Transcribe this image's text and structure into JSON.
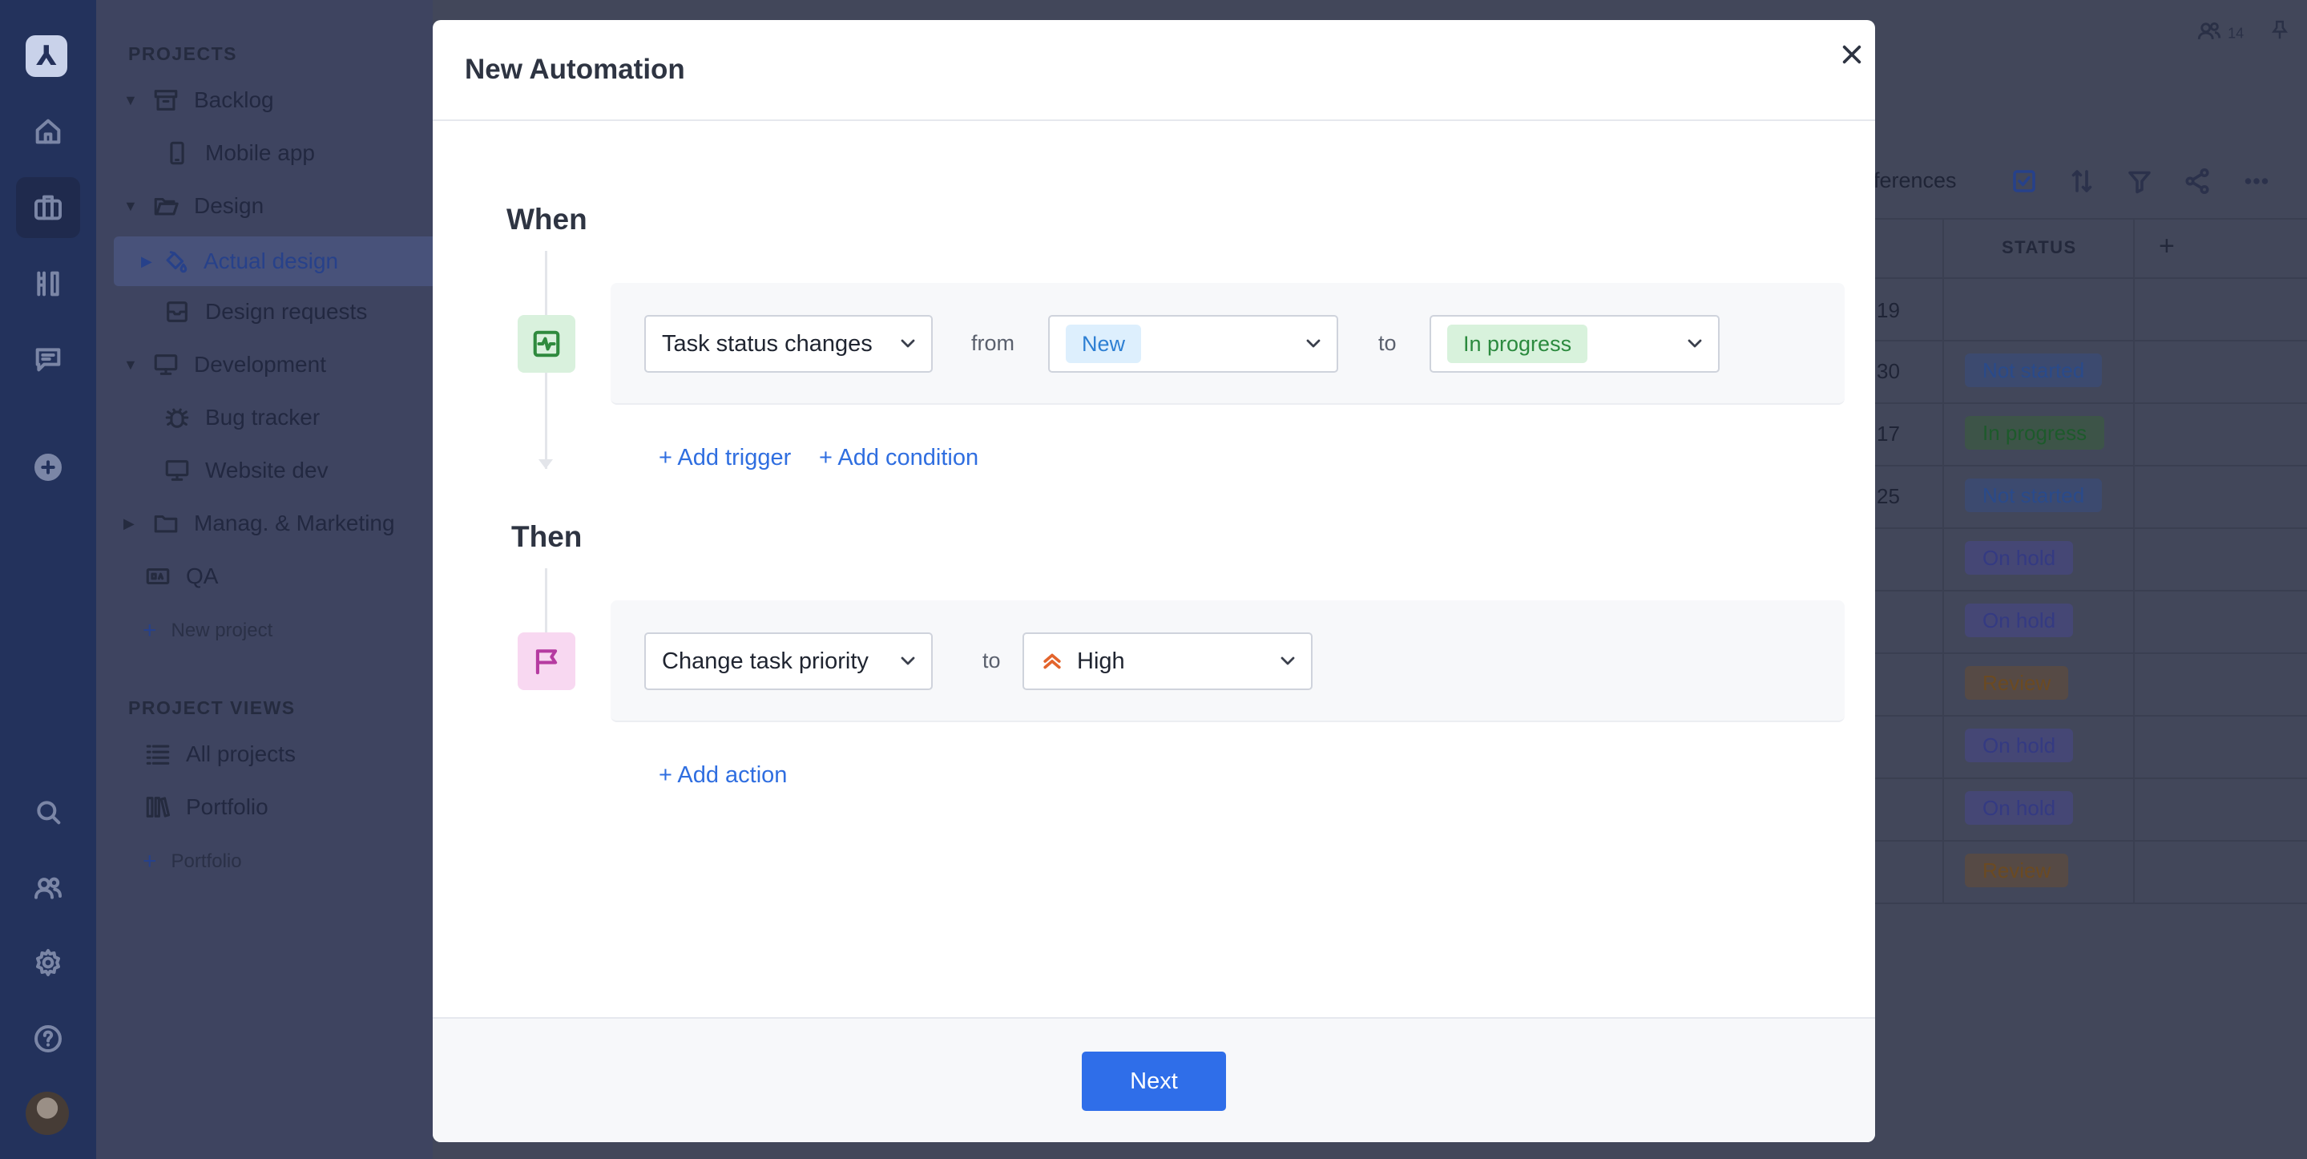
{
  "sidebar": {
    "projects_heading": "PROJECTS",
    "items": [
      {
        "label": "Backlog",
        "icon": "archive-icon"
      },
      {
        "label": "Mobile app",
        "icon": "phone-icon"
      },
      {
        "label": "Design",
        "icon": "folder-open-icon"
      },
      {
        "label": "Actual design",
        "icon": "paint-bucket-icon"
      },
      {
        "label": "Design requests",
        "icon": "inbox-icon"
      },
      {
        "label": "Development",
        "icon": "monitor-icon"
      },
      {
        "label": "Bug tracker",
        "icon": "bug-icon"
      },
      {
        "label": "Website dev",
        "icon": "monitor-icon"
      },
      {
        "label": "Manag. & Marketing",
        "icon": "folder-icon"
      },
      {
        "label": "QA",
        "icon": "qa-icon"
      }
    ],
    "new_project": "New project",
    "views_heading": "PROJECT VIEWS",
    "views": [
      {
        "label": "All projects",
        "icon": "list-icon"
      },
      {
        "label": "Portfolio",
        "icon": "books-icon"
      }
    ],
    "add_portfolio": "Portfolio"
  },
  "background": {
    "members_count": "14",
    "toolbar_text": "ferences",
    "status_header": "STATUS",
    "add_column": "+",
    "rows": [
      {
        "num": "19",
        "status": ""
      },
      {
        "num": "30",
        "status": "Not started",
        "kind": "notstarted"
      },
      {
        "num": "17",
        "status": "In progress",
        "kind": "inprogress"
      },
      {
        "num": "25",
        "status": "Not started",
        "kind": "notstarted"
      },
      {
        "num": "",
        "status": "On hold",
        "kind": "onhold"
      },
      {
        "num": "",
        "status": "On hold",
        "kind": "onhold"
      },
      {
        "num": "",
        "status": "Review",
        "kind": "review"
      },
      {
        "num": "",
        "status": "On hold",
        "kind": "onhold"
      },
      {
        "num": "",
        "status": "On hold",
        "kind": "onhold"
      },
      {
        "num": "",
        "status": "Review",
        "kind": "review"
      }
    ]
  },
  "modal": {
    "title": "New Automation",
    "when_label": "When",
    "then_label": "Then",
    "trigger": {
      "event": "Task status changes",
      "from_word": "from",
      "from_value": "New",
      "to_word": "to",
      "to_value": "In progress"
    },
    "add_trigger": "+ Add trigger",
    "add_condition": "+ Add condition",
    "action": {
      "event": "Change task priority",
      "to_word": "to",
      "priority": "High"
    },
    "add_action": "+ Add action",
    "next_button": "Next"
  },
  "colors": {
    "primary": "#2f6ee9",
    "trigger_bg": "#d9f1dd",
    "action_bg": "#f8d8f1",
    "priority_high": "#e3642c"
  }
}
